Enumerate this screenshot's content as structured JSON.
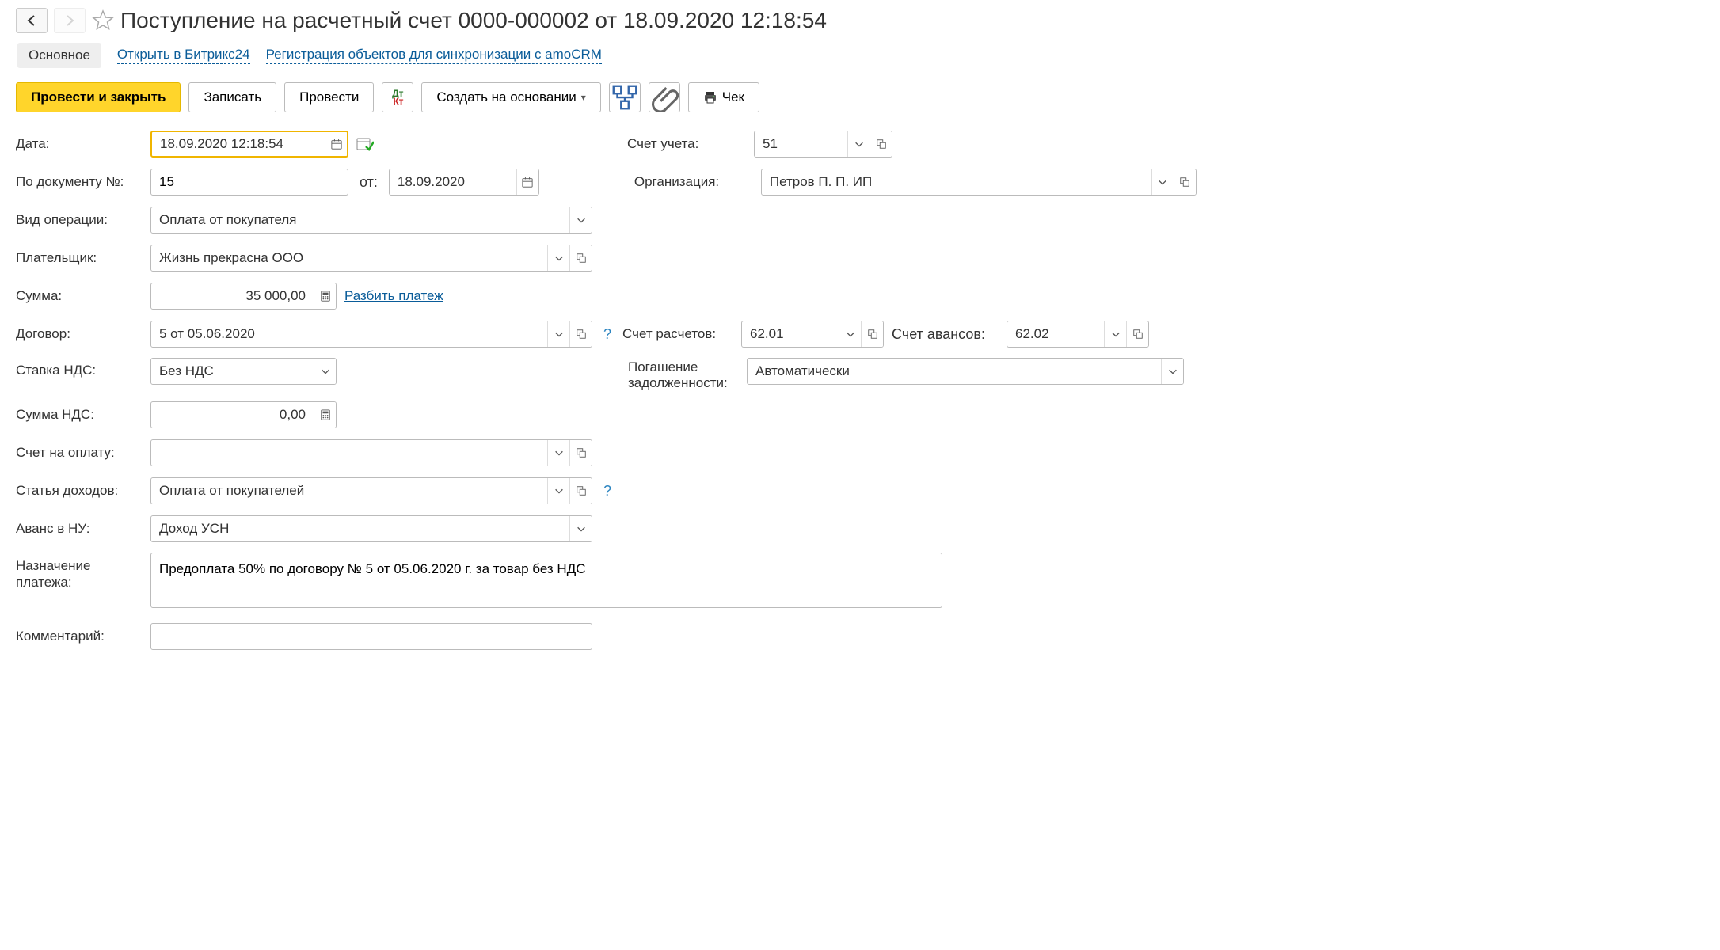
{
  "header": {
    "title": "Поступление на расчетный счет 0000-000002 от 18.09.2020 12:18:54"
  },
  "tabs": {
    "main": "Основное",
    "bitrix": "Открыть в Битрикс24",
    "amo": "Регистрация объектов для синхронизации с amoCRM"
  },
  "toolbar": {
    "post_close": "Провести и закрыть",
    "save": "Записать",
    "post": "Провести",
    "create_based": "Создать на основании",
    "cheque": "Чек"
  },
  "labels": {
    "date": "Дата:",
    "doc_no": "По документу №:",
    "from": "от:",
    "op_type": "Вид операции:",
    "payer": "Плательщик:",
    "sum": "Сумма:",
    "split": "Разбить платеж",
    "contract": "Договор:",
    "vat_rate": "Ставка НДС:",
    "vat_sum": "Сумма НДС:",
    "invoice": "Счет на оплату:",
    "income_item": "Статья доходов:",
    "advance_tax": "Аванс в НУ:",
    "purpose": "Назначение платежа:",
    "comment": "Комментарий:",
    "account": "Счет учета:",
    "org": "Организация:",
    "settle_account": "Счет расчетов:",
    "advance_account": "Счет авансов:",
    "debt_repay": "Погашение задолженности:"
  },
  "values": {
    "date": "18.09.2020 12:18:54",
    "doc_no": "15",
    "doc_date": "18.09.2020",
    "op_type": "Оплата от покупателя",
    "payer": "Жизнь прекрасна ООО",
    "sum": "35 000,00",
    "contract": "5 от 05.06.2020",
    "vat_rate": "Без НДС",
    "vat_sum": "0,00",
    "invoice": "",
    "income_item": "Оплата от покупателей",
    "advance_tax": "Доход УСН",
    "purpose": "Предоплата 50% по договору № 5 от 05.06.2020 г. за товар без НДС",
    "comment": "",
    "account": "51",
    "org": "Петров П. П. ИП",
    "settle_account": "62.01",
    "advance_account": "62.02",
    "debt_repay": "Автоматически"
  }
}
